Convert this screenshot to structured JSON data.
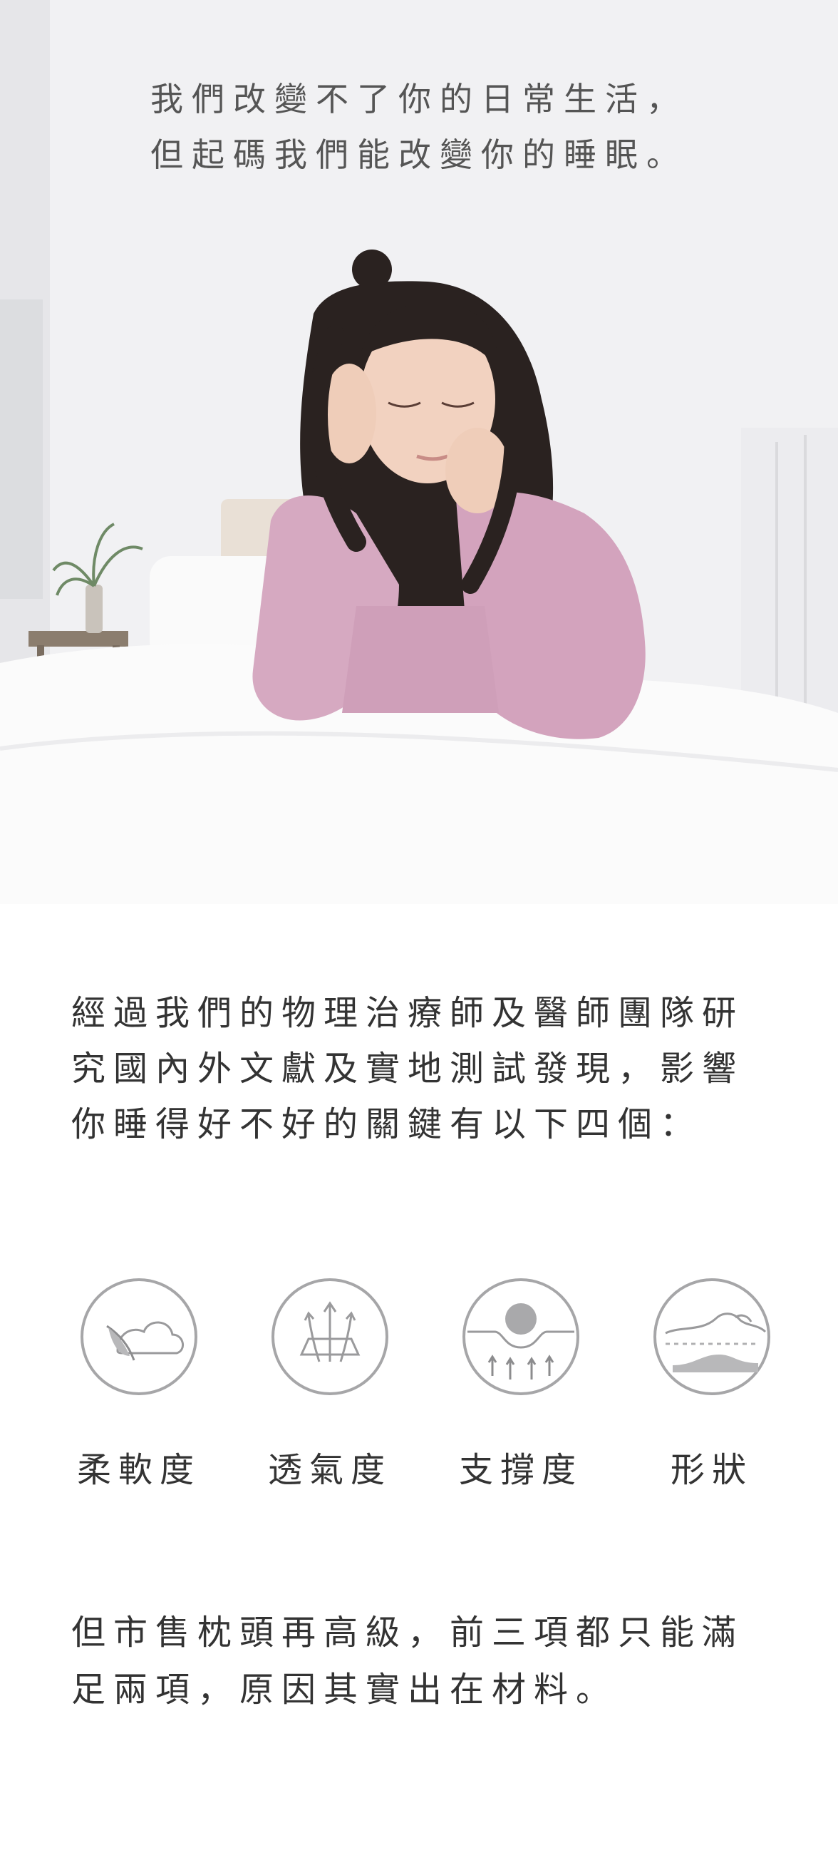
{
  "hero": {
    "headline_lines": [
      "我們改變不了你的日常生活，",
      "但起碼我們能改變你的睡眠。"
    ]
  },
  "intro": {
    "lines": [
      "經過我們的物理治療師及醫師團隊研",
      "究國內外文獻及實地測試發現，影響",
      "你睡得好不好的關鍵有以下四個："
    ]
  },
  "features": [
    {
      "label": "柔軟度",
      "icon": "feather-cloud-icon"
    },
    {
      "label": "透氣度",
      "icon": "airflow-icon"
    },
    {
      "label": "支撐度",
      "icon": "support-icon"
    },
    {
      "label": "形狀",
      "icon": "head-shape-icon"
    }
  ],
  "outro": {
    "lines": [
      "但市售枕頭再高級，前三項都只能滿",
      "足兩項，原因其實出在材料。"
    ]
  }
}
